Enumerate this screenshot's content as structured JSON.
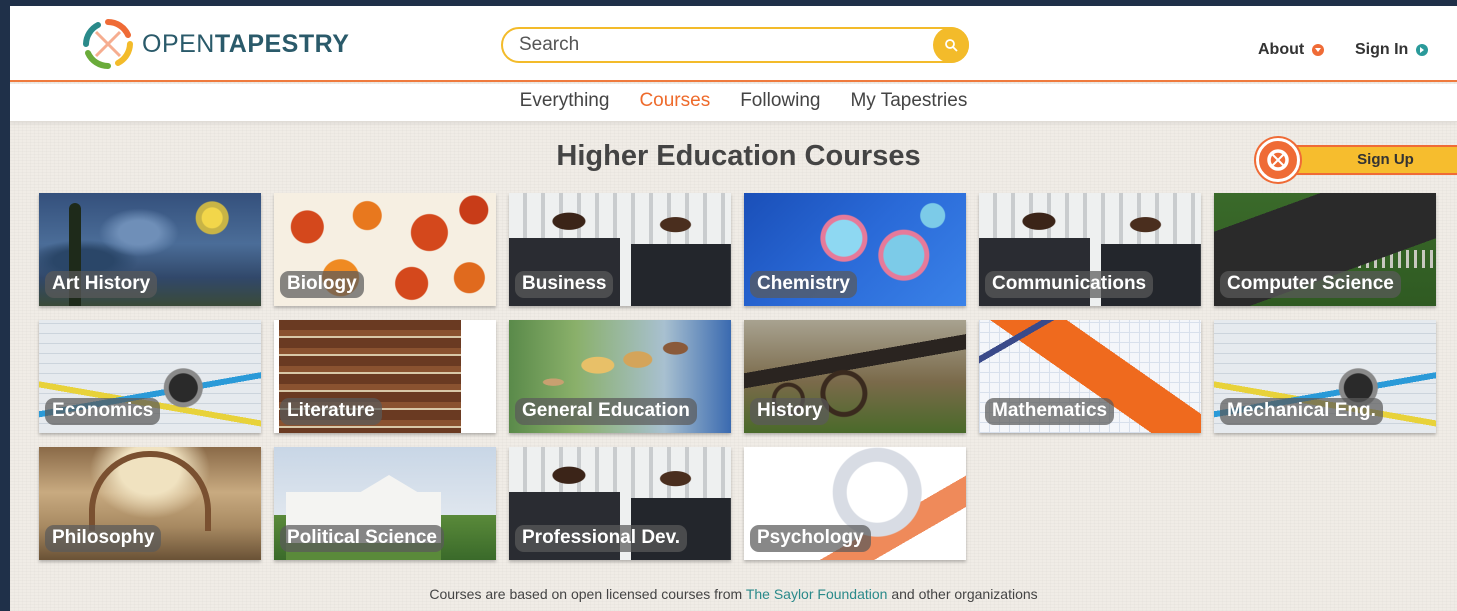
{
  "brand": {
    "name_light": "OPEN",
    "name_bold": "TAPESTRY",
    "colors": {
      "orange": "#ef6b36",
      "yellow": "#f3bb2a",
      "teal": "#2a8a8a",
      "green": "#6aab3a"
    }
  },
  "search": {
    "placeholder": "Search",
    "icon": "search-icon"
  },
  "header_links": [
    {
      "label": "About",
      "icon": "chevron-down-icon"
    },
    {
      "label": "Sign In",
      "icon": "arrow-right-icon"
    }
  ],
  "subnav": {
    "items": [
      "Everything",
      "Courses",
      "Following",
      "My Tapestries"
    ],
    "active": "Courses"
  },
  "page_title": "Higher Education Courses",
  "signup_label": "Sign Up",
  "courses": [
    {
      "label": "Art History",
      "theme": "starry-night"
    },
    {
      "label": "Biology",
      "theme": "cells"
    },
    {
      "label": "Business",
      "theme": "handshake"
    },
    {
      "label": "Chemistry",
      "theme": "petri-dish"
    },
    {
      "label": "Communications",
      "theme": "handshake"
    },
    {
      "label": "Computer Science",
      "theme": "microchip"
    },
    {
      "label": "Economics",
      "theme": "charts-compass"
    },
    {
      "label": "Literature",
      "theme": "book-stack"
    },
    {
      "label": "General Education",
      "theme": "students"
    },
    {
      "label": "History",
      "theme": "cannon"
    },
    {
      "label": "Mathematics",
      "theme": "math-paper"
    },
    {
      "label": "Mechanical Eng.",
      "theme": "charts-compass"
    },
    {
      "label": "Philosophy",
      "theme": "fresco"
    },
    {
      "label": "Political Science",
      "theme": "white-house"
    },
    {
      "label": "Professional Dev.",
      "theme": "handshake"
    },
    {
      "label": "Psychology",
      "theme": "word-sphere"
    }
  ],
  "footer": {
    "before": "Courses are based on open licensed courses from ",
    "link": "The Saylor Foundation",
    "after": " and other organizations"
  }
}
